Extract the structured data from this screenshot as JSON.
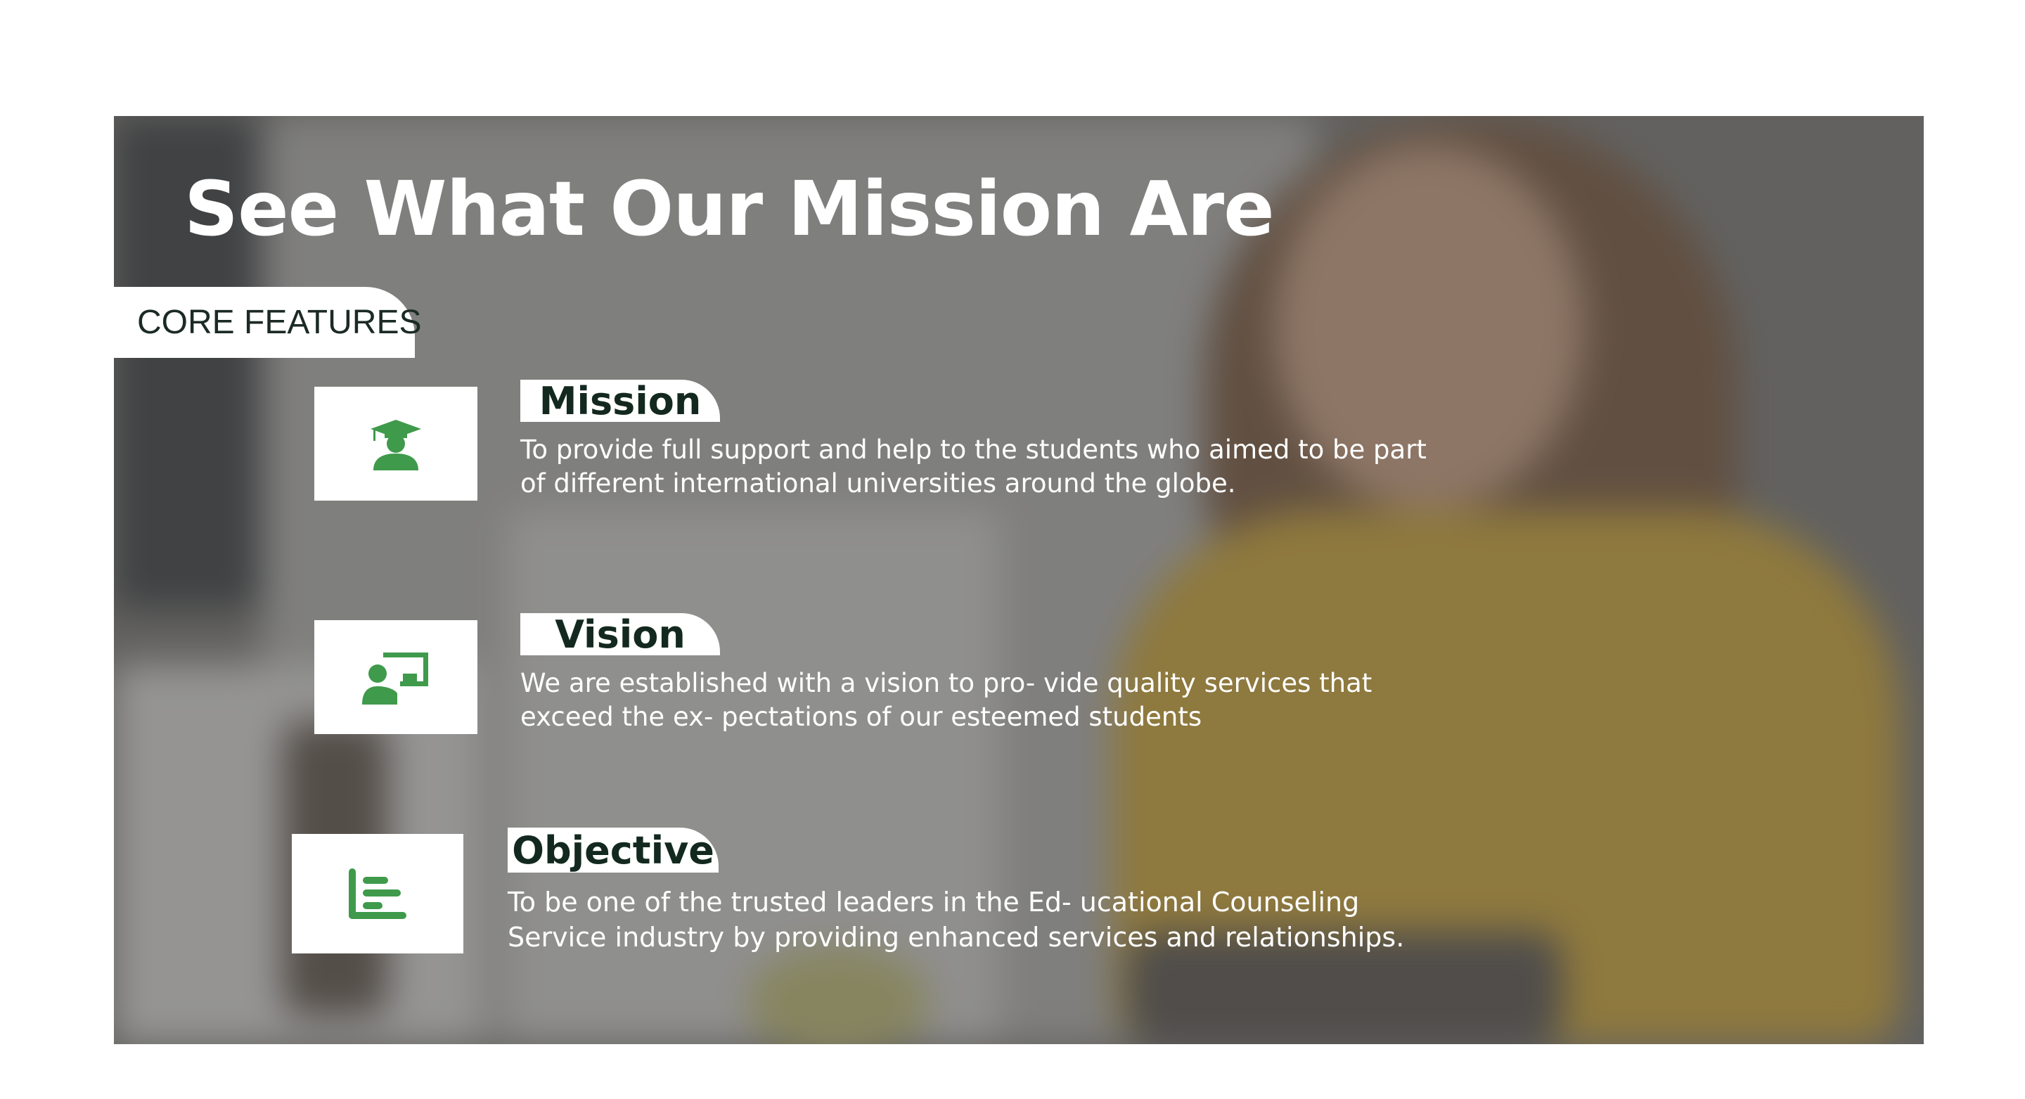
{
  "title": "See What Our Mission Are",
  "tag": "CORE FEATURES",
  "accent_color": "#3f9a4b",
  "label_text_color": "#13291f",
  "features": [
    {
      "label": "Mission",
      "icon": "graduate-icon",
      "lines": [
        "To provide full support and help to the students who aimed to be part",
        "of different international universities around the globe."
      ]
    },
    {
      "label": "Vision",
      "icon": "teacher-board-icon",
      "lines": [
        "We are established with a vision to pro- vide quality services that",
        "exceed the ex- pectations of our esteemed students"
      ]
    },
    {
      "label": "Objective",
      "icon": "bar-chart-icon",
      "lines": [
        "To be one of the trusted leaders in the Ed- ucational Counseling",
        "Service industry by providing enhanced services and relationships."
      ]
    }
  ]
}
